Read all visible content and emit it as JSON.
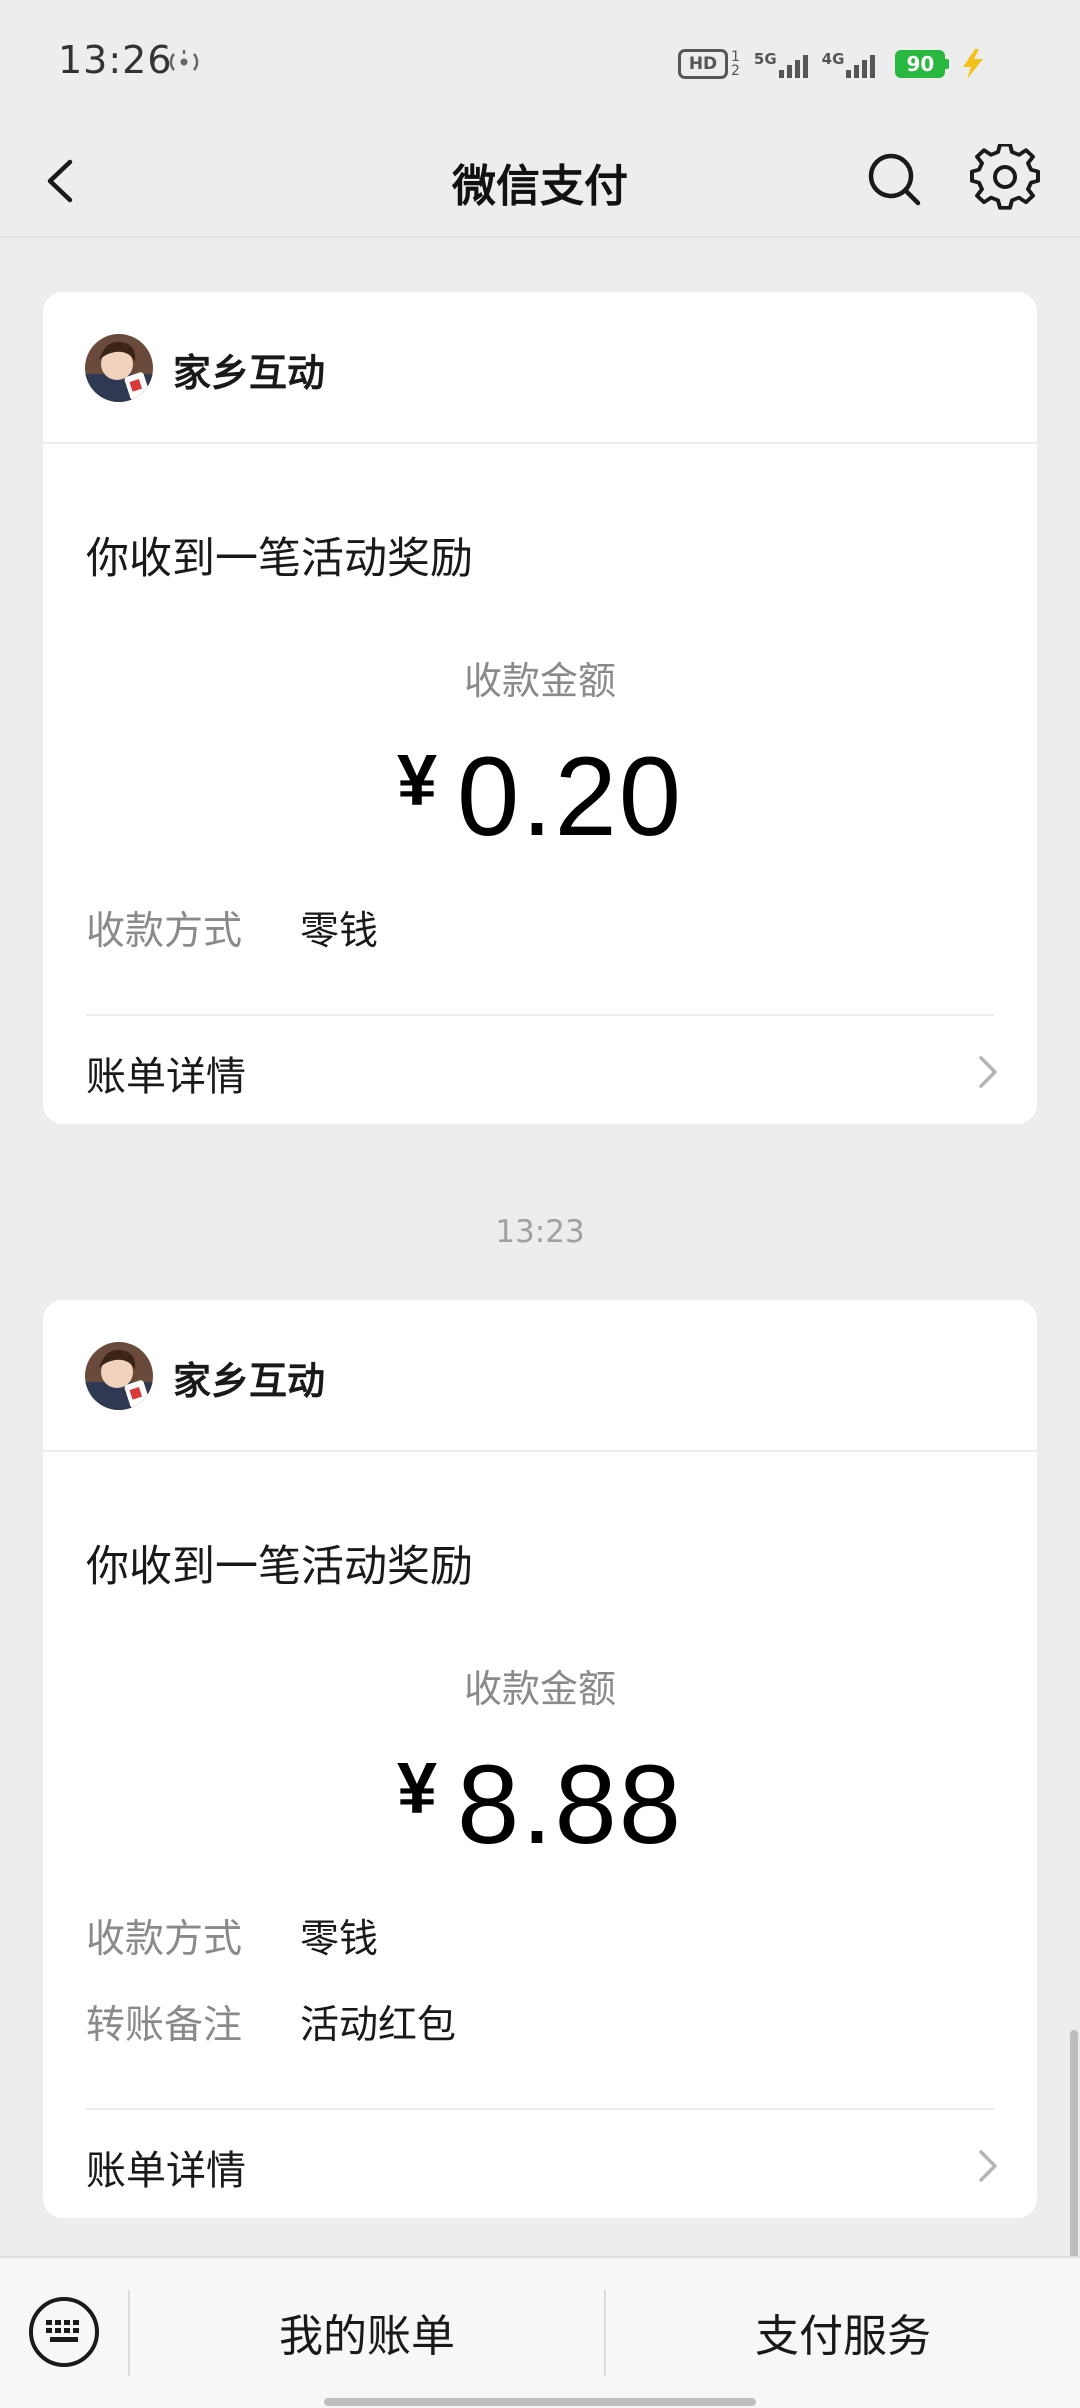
{
  "status_bar": {
    "time": "13:26",
    "hd_label": "HD",
    "sim_sub_top": "1",
    "sim_sub_bottom": "2",
    "net1_label": "5G",
    "net2_label": "4G",
    "battery": "90"
  },
  "nav": {
    "title": "微信支付",
    "back_icon": "chevron-left-icon",
    "search_icon": "search-icon",
    "settings_icon": "gear-icon"
  },
  "cards": [
    {
      "sender": "家乡互动",
      "title": "你收到一笔活动奖励",
      "amount_label": "收款金额",
      "currency": "¥",
      "amount": "0.20",
      "fields": [
        {
          "key": "收款方式",
          "value": "零钱"
        }
      ],
      "detail_label": "账单详情"
    },
    {
      "sender": "家乡互动",
      "title": "你收到一笔活动奖励",
      "amount_label": "收款金额",
      "currency": "¥",
      "amount": "8.88",
      "fields": [
        {
          "key": "收款方式",
          "value": "零钱"
        },
        {
          "key": "转账备注",
          "value": "活动红包"
        }
      ],
      "detail_label": "账单详情"
    }
  ],
  "timestamp": "13:23",
  "bottom_bar": {
    "keyboard_icon": "keyboard-icon",
    "tab1": "我的账单",
    "tab2": "支付服务"
  },
  "colors": {
    "background": "#ededed",
    "card": "#ffffff",
    "battery": "#28b73f",
    "secondary_text": "#8a8a8a"
  }
}
